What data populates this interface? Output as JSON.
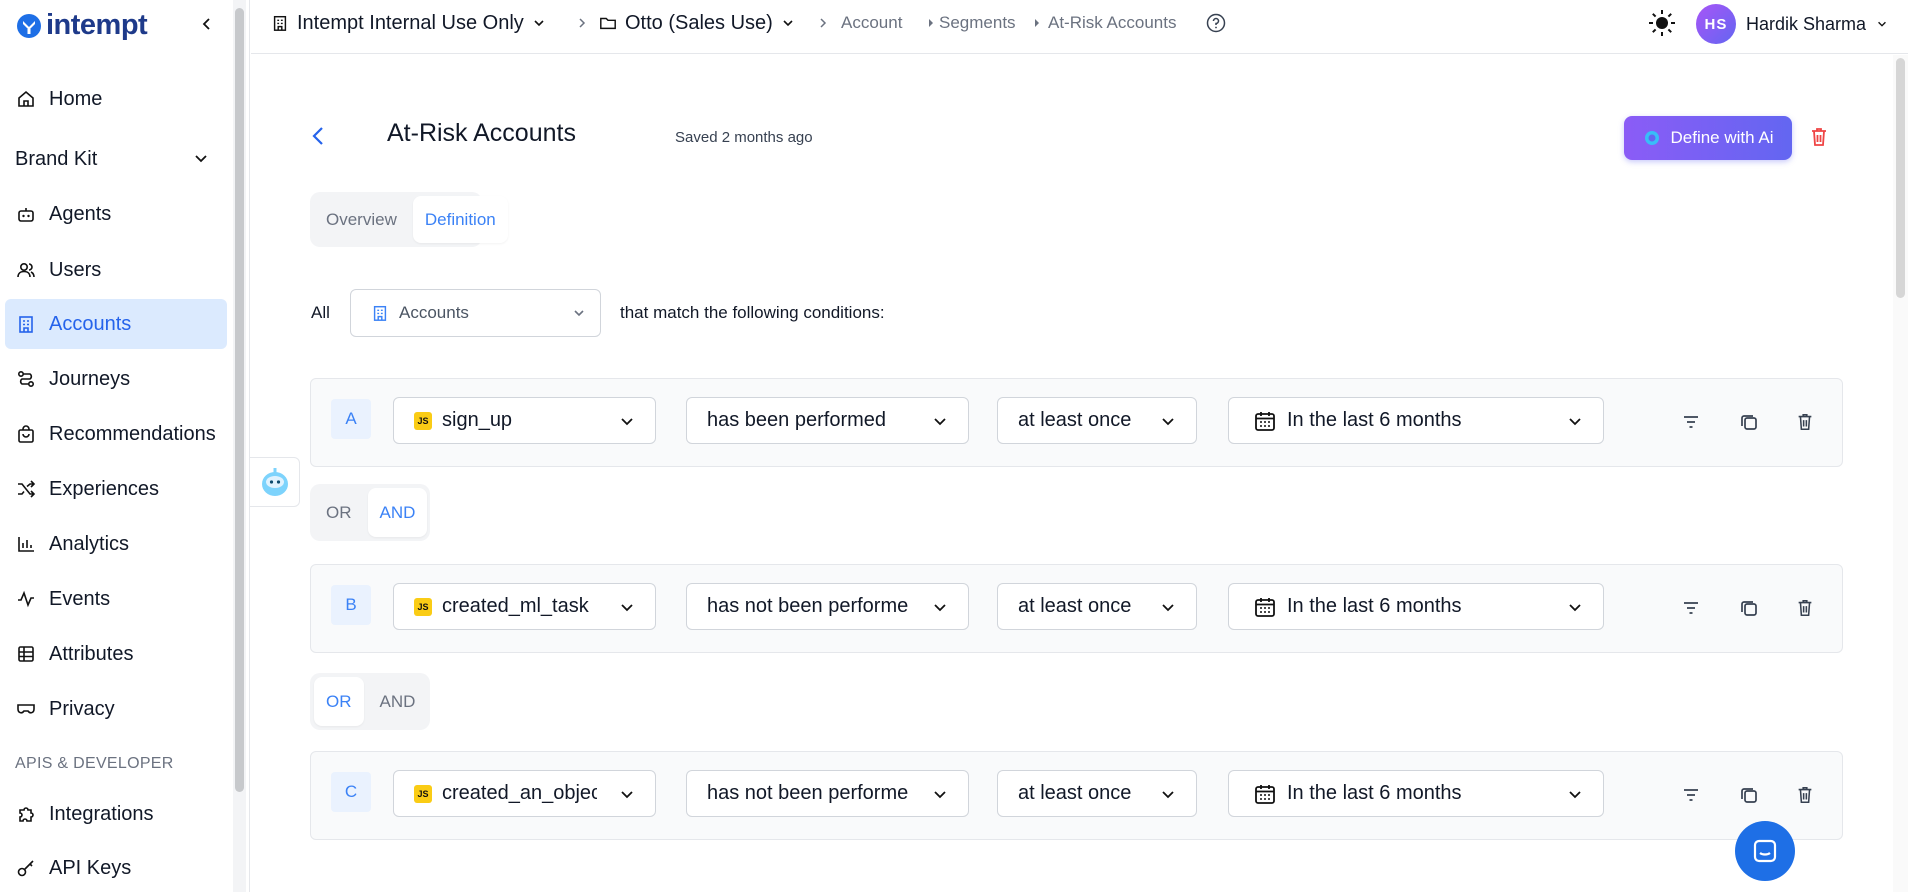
{
  "brand": {
    "name": "intempt"
  },
  "sidebar": {
    "home": "Home",
    "brand_kit": "Brand Kit",
    "agents": "Agents",
    "users": "Users",
    "accounts": "Accounts",
    "journeys": "Journeys",
    "recommendations": "Recommendations",
    "experiences": "Experiences",
    "analytics": "Analytics",
    "events": "Events",
    "attributes": "Attributes",
    "privacy": "Privacy",
    "section_apis": "APIS & DEVELOPER",
    "integrations": "Integrations",
    "api_keys": "API Keys"
  },
  "topbar": {
    "org": "Intempt Internal Use Only",
    "project": "Otto (Sales Use)",
    "crumb_account": "Account",
    "crumb_segments": "Segments",
    "crumb_current": "At-Risk Accounts",
    "user_initials": "HS",
    "user_name": "Hardik Sharma"
  },
  "page": {
    "title": "At-Risk Accounts",
    "saved": "Saved 2 months ago",
    "ai_button": "Define with Ai",
    "tab_overview": "Overview",
    "tab_definition": "Definition",
    "all_label": "All",
    "entity_select": "Accounts",
    "match_text": "that match the following conditions:"
  },
  "conditions": [
    {
      "letter": "A",
      "event": "sign_up",
      "operator": "has been performed",
      "frequency": "at least once",
      "time": "In the last 6 months"
    },
    {
      "letter": "B",
      "event": "created_ml_task",
      "operator": "has not been performe",
      "frequency": "at least once",
      "time": "In the last 6 months"
    },
    {
      "letter": "C",
      "event": "created_an_objec",
      "operator": "has not been performe",
      "frequency": "at least once",
      "time": "In the last 6 months"
    }
  ],
  "connectors": [
    {
      "or": "OR",
      "and": "AND",
      "selected": "AND"
    },
    {
      "or": "OR",
      "and": "AND",
      "selected": "OR"
    }
  ],
  "colors": {
    "accent": "#3b82f6",
    "ai_gradient_start": "#8b5cf6",
    "ai_gradient_end": "#6366f1",
    "danger": "#ef4444"
  }
}
